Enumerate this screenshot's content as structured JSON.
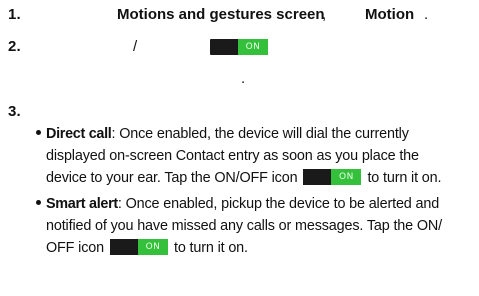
{
  "steps": [
    {
      "number": "1.",
      "text_a": "Motions and gestures screen",
      "comma": ",",
      "text_b": "Motion",
      "period": "."
    },
    {
      "number": "2.",
      "slash": "/",
      "dot": "."
    },
    {
      "number": "3."
    }
  ],
  "toggle_label": "ON",
  "bullets": [
    {
      "term": "Direct call",
      "lines": [
        ": Once enabled, the device will dial the currently",
        "displayed on-screen Contact entry as soon as you place the",
        "device to your ear. Tap the ON/OFF icon",
        "to turn it on."
      ]
    },
    {
      "term": "Smart alert",
      "lines": [
        ": Once enabled, pickup the device to be alerted and",
        "notified of you have missed any calls or messages. Tap the ON/",
        "OFF icon",
        "to turn it on."
      ]
    }
  ],
  "colors": {
    "toggle_track": "#1a1a1a",
    "toggle_knob": "#34c03a"
  }
}
